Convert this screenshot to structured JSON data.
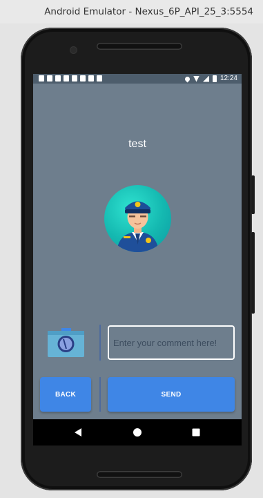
{
  "window": {
    "title": "Android Emulator - Nexus_6P_API_25_3:5554"
  },
  "status_bar": {
    "time": "12:24",
    "notification_icons": [
      "mail-icon",
      "list-icon",
      "grid-icon",
      "grid-icon",
      "person-icon",
      "person-icon",
      "person-icon",
      "sd-card-icon"
    ],
    "system_icons": [
      "location-icon",
      "wifi-icon",
      "signal-icon",
      "battery-icon"
    ]
  },
  "screen": {
    "title": "test",
    "avatar_icon": "police-officer-avatar-icon",
    "camera_icon": "camera-icon",
    "comment": {
      "value": "",
      "placeholder": "Enter your comment here!"
    },
    "back_label": "BACK",
    "send_label": "SEND"
  },
  "nav_bar": {
    "back_icon": "back-triangle-icon",
    "home_icon": "home-circle-icon",
    "recents_icon": "recents-square-icon"
  },
  "colors": {
    "screen_background": "#6e7e8d",
    "status_bar": "#4d5d6c",
    "button": "#3f86e6",
    "avatar_background": "#14b8b0",
    "divider": "#4e6a9c"
  }
}
